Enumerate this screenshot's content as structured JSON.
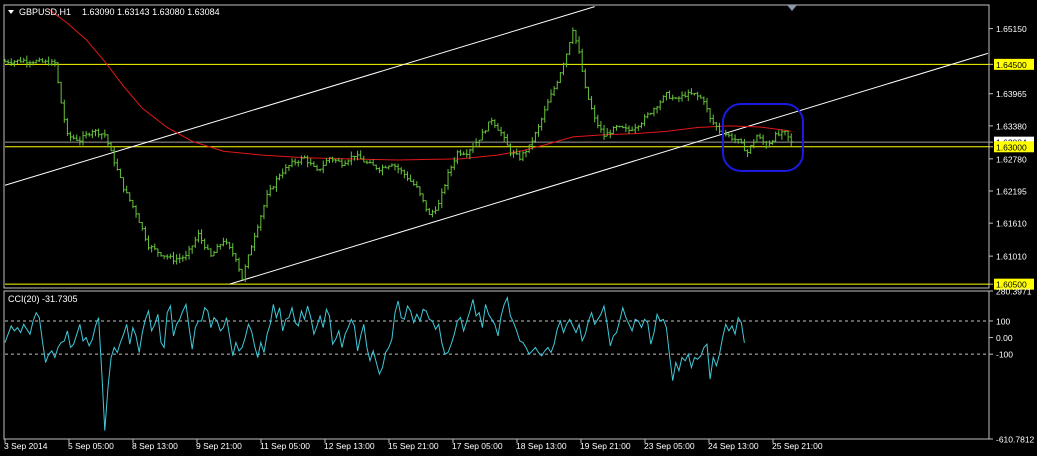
{
  "header": {
    "symbol_label": "GBPUSD,H1",
    "ohlc": "1.63090 1.63143 1.63080 1.63084"
  },
  "indicator": {
    "label": "CCI(20) -31.7305"
  },
  "colors": {
    "background": "#000000",
    "frame": "#c0c0c0",
    "bars": "#66c23a",
    "moving_average": "#e01818",
    "channel": "#ffffff",
    "horizontal_levels": "#ffff00",
    "level_tag": "#ffff00",
    "ellipse": "#1a1ae0",
    "cci_line": "#40c8d8",
    "text": "#ffffff"
  },
  "chart_data": [
    {
      "type": "ohlc",
      "title": "GBPUSD,H1",
      "ylim": [
        1.6043,
        1.6558
      ],
      "y_ticks": [
        "1.65150",
        "1.64500",
        "1.63965",
        "1.63380",
        "1.63084",
        "1.63000",
        "1.62780",
        "1.62195",
        "1.61610",
        "1.61010",
        "1.60500"
      ],
      "highlighted_levels": [
        "1.64500",
        "1.63000",
        "1.60500"
      ],
      "current_price": "1.63084",
      "x_ticks": [
        "3 Sep 2014",
        "5 Sep 05:00",
        "8 Sep 13:00",
        "9 Sep 21:00",
        "11 Sep 05:00",
        "12 Sep 13:00",
        "15 Sep 21:00",
        "17 Sep 05:00",
        "18 Sep 13:00",
        "19 Sep 21:00",
        "23 Sep 05:00",
        "24 Sep 13:00",
        "25 Sep 21:00"
      ],
      "price_path": [
        [
          0,
          1.6455
        ],
        [
          6,
          1.6457
        ],
        [
          12,
          1.6454
        ],
        [
          16,
          1.6452
        ],
        [
          18,
          1.638
        ],
        [
          20,
          1.632
        ],
        [
          24,
          1.6312
        ],
        [
          28,
          1.633
        ],
        [
          32,
          1.6322
        ],
        [
          38,
          1.6225
        ],
        [
          42,
          1.618
        ],
        [
          46,
          1.612
        ],
        [
          50,
          1.6105
        ],
        [
          54,
          1.6095
        ],
        [
          58,
          1.61
        ],
        [
          62,
          1.614
        ],
        [
          66,
          1.61
        ],
        [
          70,
          1.613
        ],
        [
          74,
          1.6098
        ],
        [
          76,
          1.606
        ],
        [
          80,
          1.614
        ],
        [
          84,
          1.621
        ],
        [
          88,
          1.625
        ],
        [
          92,
          1.627
        ],
        [
          96,
          1.628
        ],
        [
          100,
          1.6255
        ],
        [
          104,
          1.628
        ],
        [
          108,
          1.627
        ],
        [
          112,
          1.6285
        ],
        [
          116,
          1.627
        ],
        [
          120,
          1.626
        ],
        [
          124,
          1.627
        ],
        [
          128,
          1.625
        ],
        [
          132,
          1.6225
        ],
        [
          136,
          1.6175
        ],
        [
          139,
          1.6195
        ],
        [
          142,
          1.625
        ],
        [
          145,
          1.629
        ],
        [
          148,
          1.629
        ],
        [
          152,
          1.6315
        ],
        [
          156,
          1.635
        ],
        [
          159,
          1.6325
        ],
        [
          162,
          1.629
        ],
        [
          165,
          1.628
        ],
        [
          168,
          1.63
        ],
        [
          171,
          1.6335
        ],
        [
          174,
          1.638
        ],
        [
          177,
          1.642
        ],
        [
          180,
          1.647
        ],
        [
          182,
          1.6515
        ],
        [
          184,
          1.647
        ],
        [
          186,
          1.6405
        ],
        [
          189,
          1.635
        ],
        [
          192,
          1.632
        ],
        [
          196,
          1.6335
        ],
        [
          200,
          1.633
        ],
        [
          204,
          1.6345
        ],
        [
          208,
          1.637
        ],
        [
          212,
          1.6395
        ],
        [
          215,
          1.6385
        ],
        [
          218,
          1.6395
        ],
        [
          221,
          1.6395
        ],
        [
          224,
          1.6385
        ],
        [
          226,
          1.635
        ],
        [
          229,
          1.633
        ],
        [
          232,
          1.632
        ],
        [
          235,
          1.631
        ],
        [
          238,
          1.629
        ],
        [
          241,
          1.632
        ],
        [
          244,
          1.6302
        ],
        [
          247,
          1.632
        ],
        [
          250,
          1.6325
        ],
        [
          252,
          1.6308
        ]
      ],
      "moving_average_path": [
        [
          14,
          1.655
        ],
        [
          20,
          1.6525
        ],
        [
          26,
          1.6495
        ],
        [
          32,
          1.6455
        ],
        [
          38,
          1.641
        ],
        [
          44,
          1.637
        ],
        [
          52,
          1.6335
        ],
        [
          60,
          1.631
        ],
        [
          70,
          1.6292
        ],
        [
          82,
          1.6285
        ],
        [
          96,
          1.628
        ],
        [
          110,
          1.6278
        ],
        [
          126,
          1.6276
        ],
        [
          136,
          1.6277
        ],
        [
          146,
          1.6278
        ],
        [
          158,
          1.6285
        ],
        [
          166,
          1.6293
        ],
        [
          174,
          1.6305
        ],
        [
          182,
          1.6318
        ],
        [
          192,
          1.6322
        ],
        [
          202,
          1.6324
        ],
        [
          212,
          1.6328
        ],
        [
          222,
          1.6335
        ],
        [
          232,
          1.6338
        ],
        [
          242,
          1.6336
        ],
        [
          250,
          1.633
        ],
        [
          252,
          1.6328
        ]
      ],
      "channel_lines": [
        {
          "from": [
            0,
            1.623
          ],
          "to": [
            189,
            1.6555
          ]
        },
        {
          "from": [
            72,
            1.605
          ],
          "to": [
            315,
            1.647
          ]
        }
      ]
    },
    {
      "type": "line",
      "title": "CCI(20) -31.7305",
      "ylim": [
        -610.7812,
        280.3971
      ],
      "y_ticks": [
        "280.3971",
        "100",
        "0.00",
        "-100",
        "-610.7812"
      ],
      "reference_levels": [
        100,
        -100
      ],
      "values": [
        -30,
        20,
        70,
        40,
        60,
        30,
        80,
        50,
        20,
        100,
        150,
        120,
        -20,
        -150,
        -100,
        -80,
        -120,
        -60,
        -30,
        -20,
        40,
        -60,
        -40,
        20,
        80,
        -20,
        0,
        -50,
        -10,
        70,
        120,
        -200,
        -560,
        -300,
        -120,
        -60,
        -90,
        -30,
        20,
        80,
        -40,
        60,
        10,
        -90,
        30,
        110,
        160,
        40,
        80,
        140,
        -30,
        -60,
        150,
        190,
        10,
        80,
        110,
        160,
        200,
        60,
        -70,
        60,
        100,
        100,
        180,
        160,
        60,
        120,
        100,
        40,
        60,
        120,
        10,
        -110,
        -30,
        -80,
        -60,
        0,
        80,
        40,
        -50,
        -120,
        -30,
        -90,
        20,
        80,
        200,
        120,
        180,
        40,
        110,
        120,
        180,
        90,
        70,
        160,
        110,
        190,
        120,
        20,
        70,
        130,
        60,
        170,
        130,
        -40,
        -10,
        40,
        -60,
        20,
        60,
        110,
        70,
        -80,
        10,
        80,
        -60,
        -140,
        -80,
        -150,
        -220,
        -180,
        -90,
        -60,
        -10,
        150,
        220,
        120,
        110,
        190,
        160,
        90,
        140,
        100,
        170,
        160,
        110,
        100,
        50,
        80,
        -30,
        -100,
        -90,
        -40,
        20,
        100,
        120,
        40,
        100,
        160,
        230,
        130,
        150,
        60,
        200,
        140,
        110,
        80,
        10,
        130,
        200,
        240,
        130,
        90,
        40,
        -20,
        -30,
        -60,
        -100,
        -80,
        -60,
        -90,
        -110,
        -80,
        -60,
        -90,
        -40,
        50,
        100,
        30,
        80,
        110,
        70,
        30,
        80,
        -20,
        20,
        100,
        150,
        80,
        110,
        140,
        190,
        80,
        -50,
        10,
        30,
        100,
        180,
        120,
        80,
        40,
        110,
        100,
        60,
        110,
        90,
        -40,
        30,
        140,
        100,
        110,
        60,
        -110,
        -260,
        -150,
        -200,
        -120,
        -140,
        -100,
        -180,
        -120,
        -130,
        -110,
        -60,
        -40,
        -250,
        -120,
        -170,
        -100,
        0,
        80,
        40,
        70,
        20,
        120,
        90,
        -31.7
      ]
    }
  ]
}
